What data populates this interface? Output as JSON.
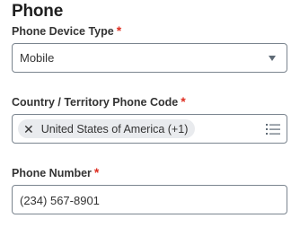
{
  "section": {
    "title": "Phone"
  },
  "phone_device_type": {
    "label": "Phone Device Type",
    "required_marker": "*",
    "value": "Mobile",
    "icon": "chevron-down-icon"
  },
  "country_code": {
    "label": "Country / Territory Phone Code",
    "required_marker": "*",
    "selected": "United States of America (+1)",
    "remove_icon": "close-icon",
    "list_icon": "list-icon"
  },
  "phone_number": {
    "label": "Phone Number",
    "required_marker": "*",
    "value": "(234) 567-8901"
  },
  "colors": {
    "required": "#de2e21",
    "border": "#7b858f",
    "pill_bg": "#e9ebee",
    "text": "#333333"
  }
}
